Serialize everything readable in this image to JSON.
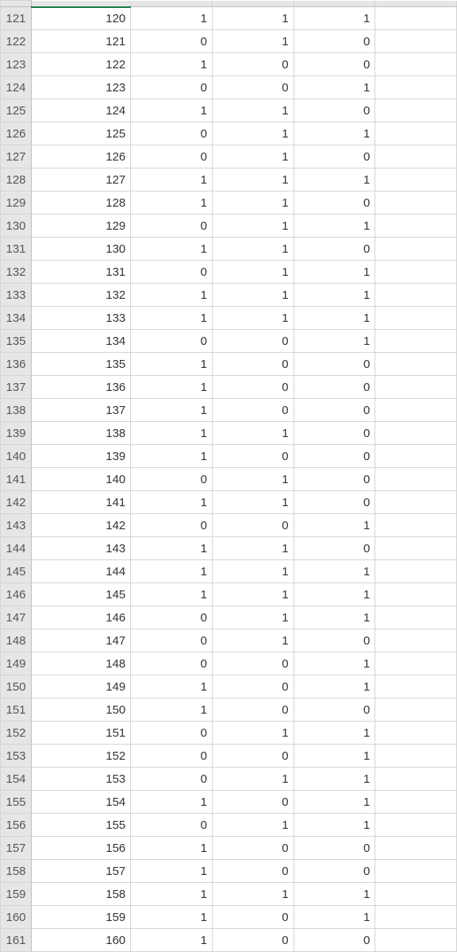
{
  "rowHeaders": [
    "121",
    "122",
    "123",
    "124",
    "125",
    "126",
    "127",
    "128",
    "129",
    "130",
    "131",
    "132",
    "133",
    "134",
    "135",
    "136",
    "137",
    "138",
    "139",
    "140",
    "141",
    "142",
    "143",
    "144",
    "145",
    "146",
    "147",
    "148",
    "149",
    "150",
    "151",
    "152",
    "153",
    "154",
    "155",
    "156",
    "157",
    "158",
    "159",
    "160",
    "161"
  ],
  "rows": [
    {
      "a": "120",
      "b": "1",
      "c": "1",
      "d": "1",
      "e": ""
    },
    {
      "a": "121",
      "b": "0",
      "c": "1",
      "d": "0",
      "e": ""
    },
    {
      "a": "122",
      "b": "1",
      "c": "0",
      "d": "0",
      "e": ""
    },
    {
      "a": "123",
      "b": "0",
      "c": "0",
      "d": "1",
      "e": ""
    },
    {
      "a": "124",
      "b": "1",
      "c": "1",
      "d": "0",
      "e": ""
    },
    {
      "a": "125",
      "b": "0",
      "c": "1",
      "d": "1",
      "e": ""
    },
    {
      "a": "126",
      "b": "0",
      "c": "1",
      "d": "0",
      "e": ""
    },
    {
      "a": "127",
      "b": "1",
      "c": "1",
      "d": "1",
      "e": ""
    },
    {
      "a": "128",
      "b": "1",
      "c": "1",
      "d": "0",
      "e": ""
    },
    {
      "a": "129",
      "b": "0",
      "c": "1",
      "d": "1",
      "e": ""
    },
    {
      "a": "130",
      "b": "1",
      "c": "1",
      "d": "0",
      "e": ""
    },
    {
      "a": "131",
      "b": "0",
      "c": "1",
      "d": "1",
      "e": ""
    },
    {
      "a": "132",
      "b": "1",
      "c": "1",
      "d": "1",
      "e": ""
    },
    {
      "a": "133",
      "b": "1",
      "c": "1",
      "d": "1",
      "e": ""
    },
    {
      "a": "134",
      "b": "0",
      "c": "0",
      "d": "1",
      "e": ""
    },
    {
      "a": "135",
      "b": "1",
      "c": "0",
      "d": "0",
      "e": ""
    },
    {
      "a": "136",
      "b": "1",
      "c": "0",
      "d": "0",
      "e": ""
    },
    {
      "a": "137",
      "b": "1",
      "c": "0",
      "d": "0",
      "e": ""
    },
    {
      "a": "138",
      "b": "1",
      "c": "1",
      "d": "0",
      "e": ""
    },
    {
      "a": "139",
      "b": "1",
      "c": "0",
      "d": "0",
      "e": ""
    },
    {
      "a": "140",
      "b": "0",
      "c": "1",
      "d": "0",
      "e": ""
    },
    {
      "a": "141",
      "b": "1",
      "c": "1",
      "d": "0",
      "e": ""
    },
    {
      "a": "142",
      "b": "0",
      "c": "0",
      "d": "1",
      "e": ""
    },
    {
      "a": "143",
      "b": "1",
      "c": "1",
      "d": "0",
      "e": ""
    },
    {
      "a": "144",
      "b": "1",
      "c": "1",
      "d": "1",
      "e": ""
    },
    {
      "a": "145",
      "b": "1",
      "c": "1",
      "d": "1",
      "e": ""
    },
    {
      "a": "146",
      "b": "0",
      "c": "1",
      "d": "1",
      "e": ""
    },
    {
      "a": "147",
      "b": "0",
      "c": "1",
      "d": "0",
      "e": ""
    },
    {
      "a": "148",
      "b": "0",
      "c": "0",
      "d": "1",
      "e": ""
    },
    {
      "a": "149",
      "b": "1",
      "c": "0",
      "d": "1",
      "e": ""
    },
    {
      "a": "150",
      "b": "1",
      "c": "0",
      "d": "0",
      "e": ""
    },
    {
      "a": "151",
      "b": "0",
      "c": "1",
      "d": "1",
      "e": ""
    },
    {
      "a": "152",
      "b": "0",
      "c": "0",
      "d": "1",
      "e": ""
    },
    {
      "a": "153",
      "b": "0",
      "c": "1",
      "d": "1",
      "e": ""
    },
    {
      "a": "154",
      "b": "1",
      "c": "0",
      "d": "1",
      "e": ""
    },
    {
      "a": "155",
      "b": "0",
      "c": "1",
      "d": "1",
      "e": ""
    },
    {
      "a": "156",
      "b": "1",
      "c": "0",
      "d": "0",
      "e": ""
    },
    {
      "a": "157",
      "b": "1",
      "c": "0",
      "d": "0",
      "e": ""
    },
    {
      "a": "158",
      "b": "1",
      "c": "1",
      "d": "1",
      "e": ""
    },
    {
      "a": "159",
      "b": "1",
      "c": "0",
      "d": "1",
      "e": ""
    },
    {
      "a": "160",
      "b": "1",
      "c": "0",
      "d": "0",
      "e": ""
    }
  ]
}
